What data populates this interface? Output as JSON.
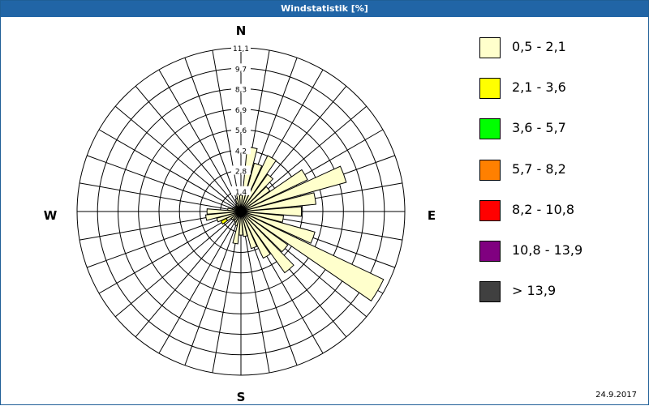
{
  "window": {
    "title": "Windstatistik [%]"
  },
  "footer": {
    "date": "24.9.2017"
  },
  "chart_data": {
    "type": "wind-rose",
    "title": "Windstatistik [%]",
    "directions": [
      "N",
      "E",
      "S",
      "W"
    ],
    "ring_labels": [
      "1,4",
      "2,8",
      "4,2",
      "5,6",
      "6,9",
      "8,3",
      "9,7",
      "11,1"
    ],
    "r_max": 11.1,
    "sector_count": 36,
    "legend": [
      {
        "label": "0,5 - 2,1",
        "color": "#ffffcc"
      },
      {
        "label": "2,1 - 3,6",
        "color": "#ffff00"
      },
      {
        "label": "3,6 - 5,7",
        "color": "#00ff00"
      },
      {
        "label": "5,7 - 8,2",
        "color": "#ff8000"
      },
      {
        "label": "8,2 - 10,8",
        "color": "#ff0000"
      },
      {
        "label": "10,8 - 13,9",
        "color": "#800080"
      },
      {
        "label": "> 13,9",
        "color": "#404040"
      }
    ],
    "sectors": [
      {
        "dir": 0,
        "values": [
          1.1
        ]
      },
      {
        "dir": 10,
        "values": [
          4.4
        ]
      },
      {
        "dir": 20,
        "values": [
          3.4
        ]
      },
      {
        "dir": 30,
        "values": [
          4.2
        ]
      },
      {
        "dir": 40,
        "values": [
          3.1
        ]
      },
      {
        "dir": 50,
        "values": [
          2.4
        ]
      },
      {
        "dir": 60,
        "values": [
          5.0
        ]
      },
      {
        "dir": 70,
        "values": [
          7.4
        ]
      },
      {
        "dir": 80,
        "values": [
          5.1
        ]
      },
      {
        "dir": 90,
        "values": [
          4.1
        ]
      },
      {
        "dir": 100,
        "values": [
          2.9
        ]
      },
      {
        "dir": 110,
        "values": [
          5.2
        ]
      },
      {
        "dir": 120,
        "values": [
          10.7
        ]
      },
      {
        "dir": 130,
        "values": [
          3.9
        ]
      },
      {
        "dir": 140,
        "values": [
          5.1
        ]
      },
      {
        "dir": 150,
        "values": [
          3.5
        ]
      },
      {
        "dir": 160,
        "values": [
          2.6
        ]
      },
      {
        "dir": 170,
        "values": [
          1.7
        ]
      },
      {
        "dir": 180,
        "values": [
          1.6
        ]
      },
      {
        "dir": 190,
        "values": [
          2.2
        ]
      },
      {
        "dir": 200,
        "values": [
          1.0
        ]
      },
      {
        "dir": 210,
        "values": [
          0.8
        ]
      },
      {
        "dir": 220,
        "values": [
          0.7
        ]
      },
      {
        "dir": 230,
        "values": [
          0.8
        ]
      },
      {
        "dir": 240,
        "values": [
          1.1,
          0.4
        ]
      },
      {
        "dir": 250,
        "values": [
          1.7
        ]
      },
      {
        "dir": 260,
        "values": [
          2.4
        ]
      },
      {
        "dir": 270,
        "values": [
          2.3
        ]
      },
      {
        "dir": 280,
        "values": [
          0.9
        ]
      },
      {
        "dir": 290,
        "values": [
          0.6
        ]
      },
      {
        "dir": 300,
        "values": [
          0.5
        ]
      },
      {
        "dir": 310,
        "values": [
          0.5
        ]
      },
      {
        "dir": 320,
        "values": [
          0.4
        ]
      },
      {
        "dir": 330,
        "values": [
          0.6
        ]
      },
      {
        "dir": 340,
        "values": [
          0.9
        ]
      },
      {
        "dir": 350,
        "values": [
          1.2
        ]
      }
    ]
  }
}
